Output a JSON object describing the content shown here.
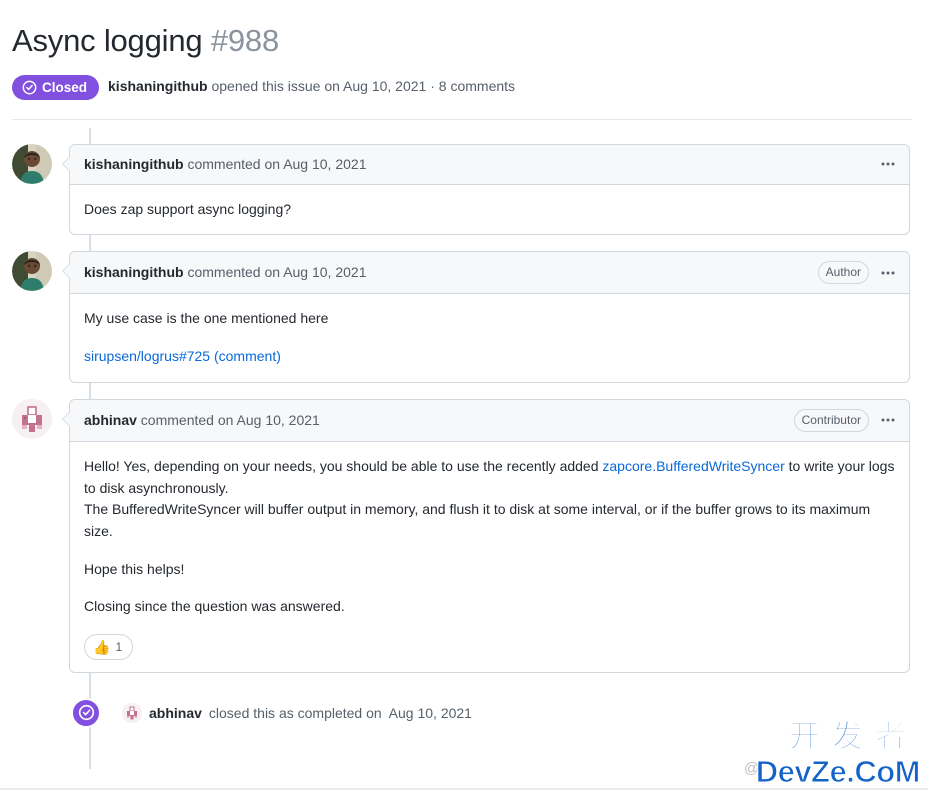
{
  "issue": {
    "title": "Async logging",
    "number": "#988",
    "state_label": "Closed",
    "state_icon": "issue-closed-icon",
    "state_color": "#8250df",
    "opened_by": "kishaningithub",
    "meta_action": "opened this issue on",
    "opened_date": "Aug 10, 2021",
    "meta_separator": "·",
    "comment_count": "8 comments"
  },
  "timeline": [
    {
      "id": "comment-1",
      "avatar": "avatar-kishaningithub",
      "author": "kishaningithub",
      "action": "commented on",
      "date": "Aug 10, 2021",
      "role_label": "",
      "menu_icon": "kebab-horizontal-icon",
      "paragraphs": [
        {
          "type": "text",
          "text": "Does zap support async logging?"
        }
      ],
      "reactions": []
    },
    {
      "id": "comment-2",
      "avatar": "avatar-kishaningithub",
      "author": "kishaningithub",
      "action": "commented on",
      "date": "Aug 10, 2021",
      "role_label": "Author",
      "menu_icon": "kebab-horizontal-icon",
      "paragraphs": [
        {
          "type": "text",
          "text": "My use case is the one mentioned here"
        },
        {
          "type": "link",
          "text": "sirupsen/logrus#725 (comment)"
        }
      ],
      "reactions": []
    },
    {
      "id": "comment-3",
      "avatar": "avatar-abhinav",
      "author": "abhinav",
      "action": "commented on",
      "date": "Aug 10, 2021",
      "role_label": "Contributor",
      "menu_icon": "kebab-horizontal-icon",
      "paragraphs": [
        {
          "type": "rich",
          "before": "Hello! Yes, depending on your needs, you should be able to use the recently added ",
          "link": "zapcore.BufferedWriteSyncer",
          "after": " to write your logs to disk asynchronously.",
          "line2": "The BufferedWriteSyncer will buffer output in memory, and flush it to disk at some interval, or if the buffer grows to its maximum size."
        },
        {
          "type": "text",
          "text": "Hope this helps!"
        },
        {
          "type": "text",
          "text": "Closing since the question was answered."
        }
      ],
      "reactions": [
        {
          "emoji": "👍",
          "name": "thumbs-up-reaction",
          "count": "1"
        }
      ]
    }
  ],
  "closed_event": {
    "icon": "issue-closed-icon",
    "avatar": "avatar-abhinav",
    "actor": "abhinav",
    "text": "closed this as completed on",
    "date": "Aug 10, 2021"
  },
  "watermark": {
    "at": "@",
    "chinese": "开发者",
    "site": "DevZe.CoM",
    "color": "#1463c8"
  }
}
